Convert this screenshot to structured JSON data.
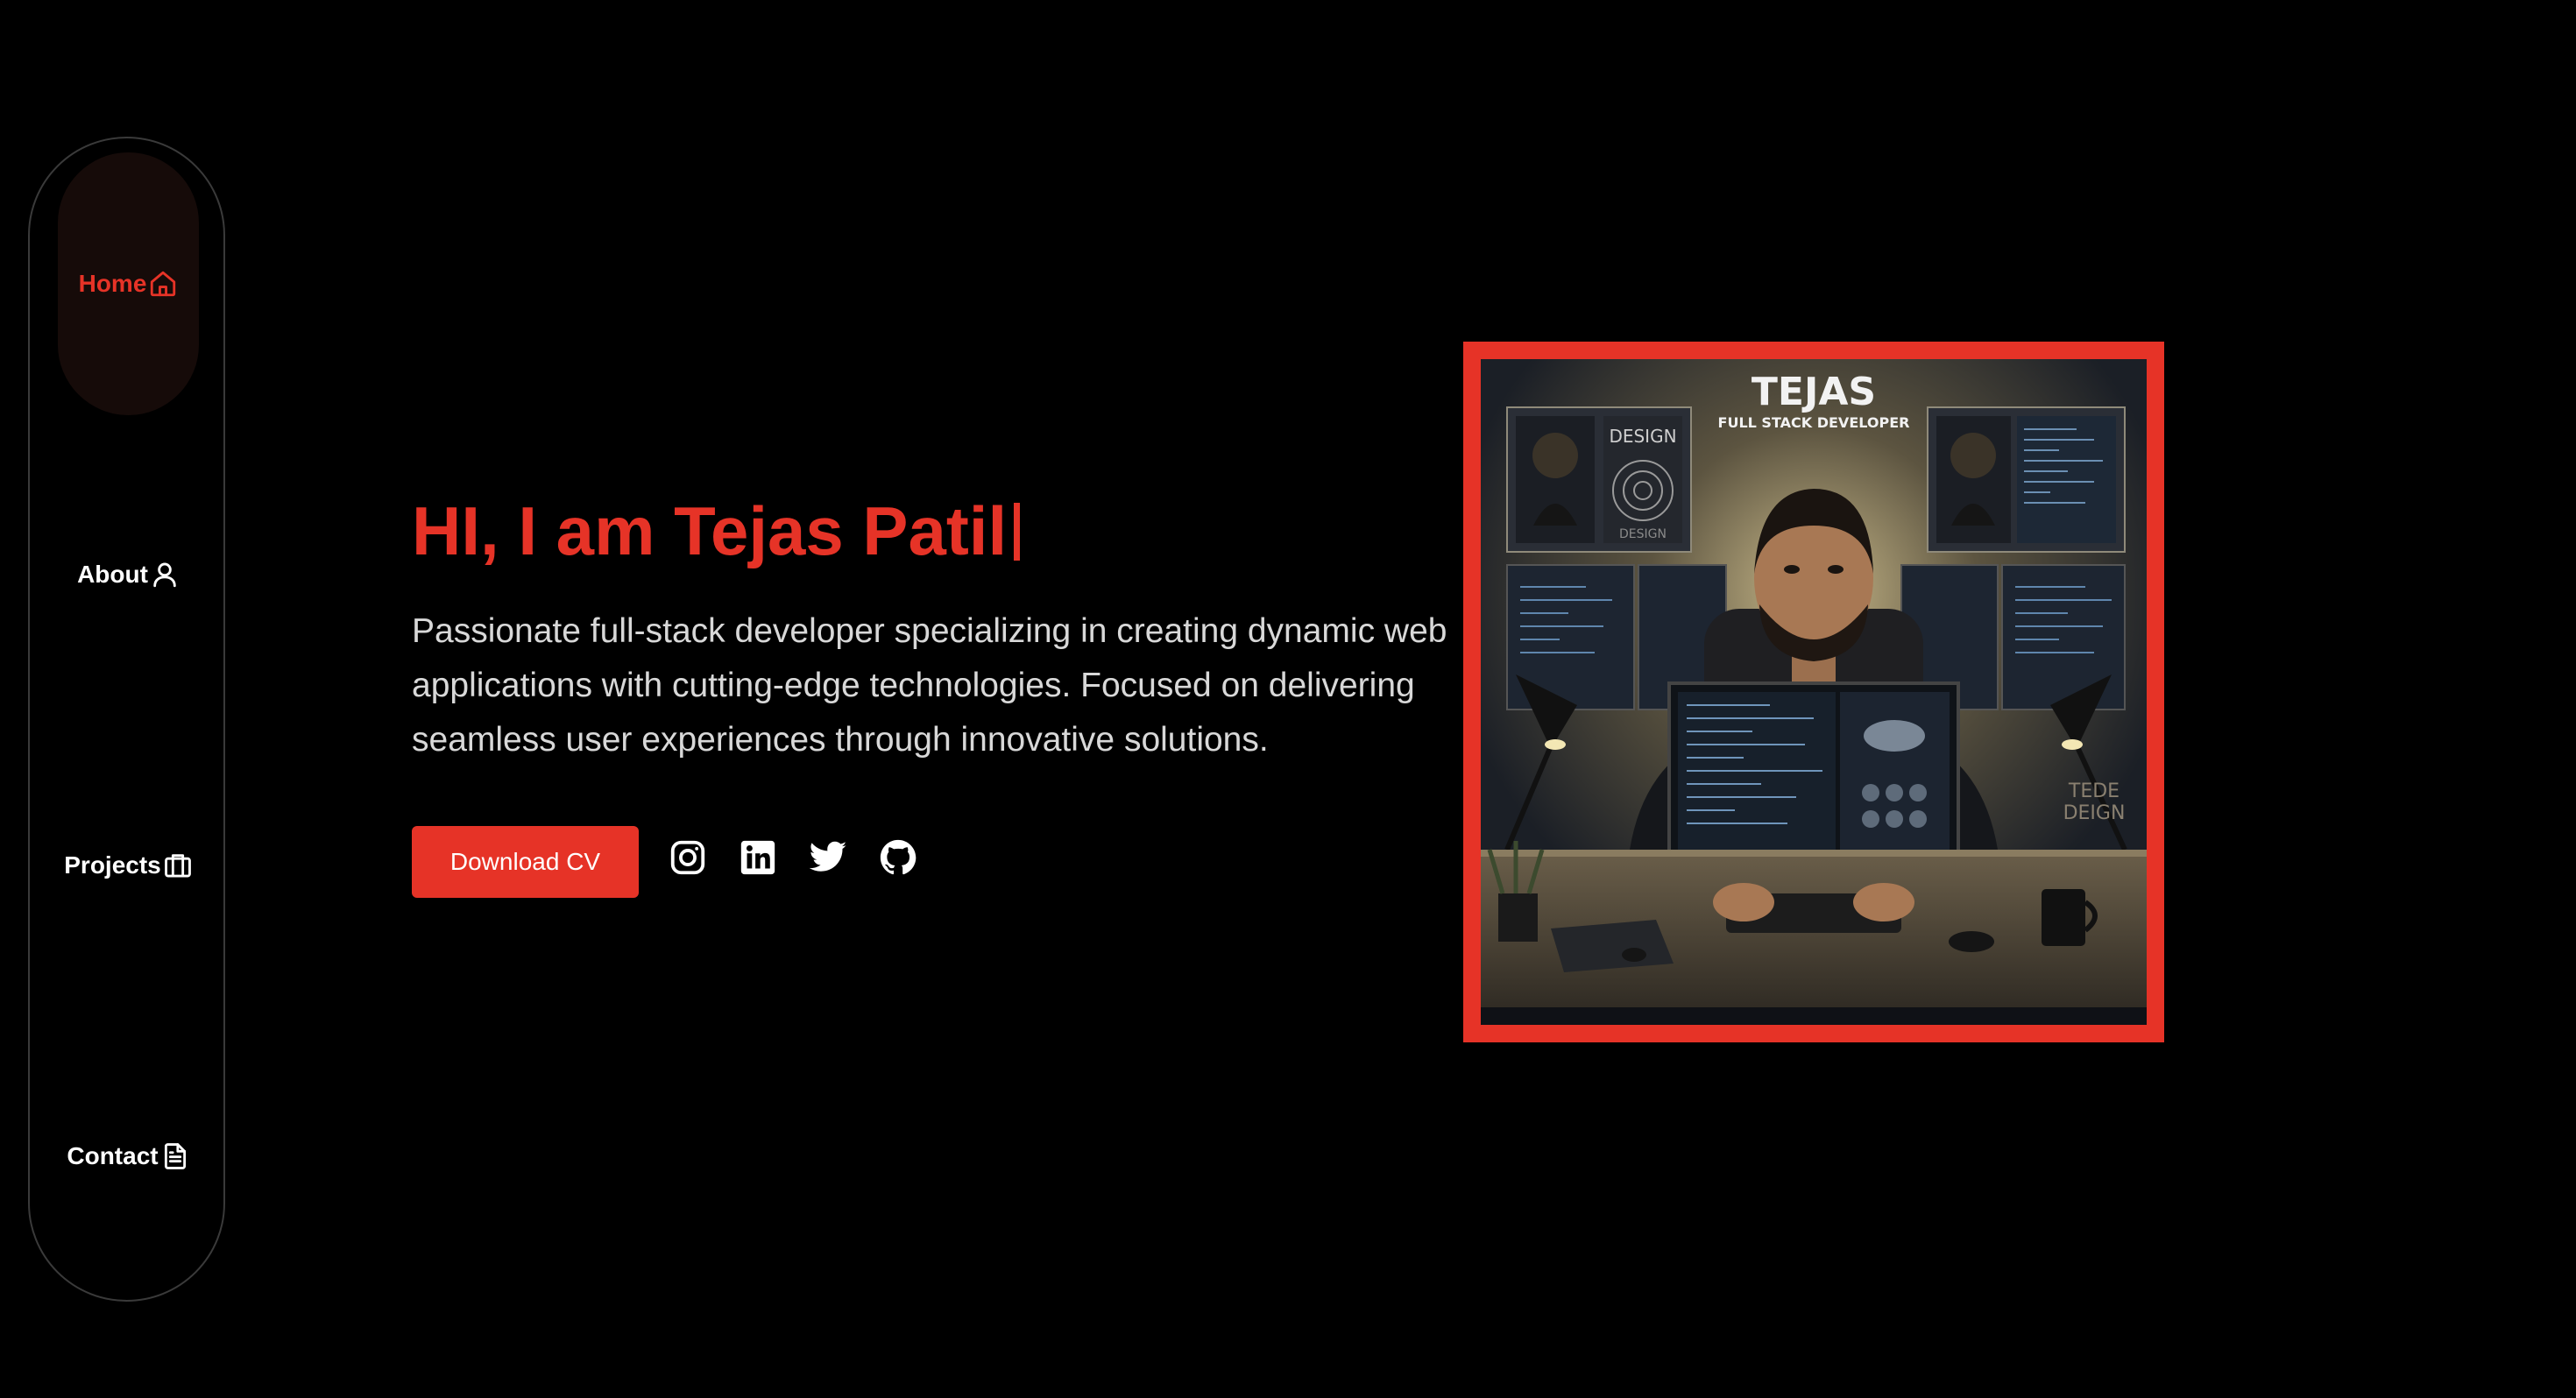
{
  "nav": {
    "items": [
      {
        "label": "Home",
        "icon": "home-icon",
        "active": true
      },
      {
        "label": "About",
        "icon": "user-icon",
        "active": false
      },
      {
        "label": "Projects",
        "icon": "briefcase-icon",
        "active": false
      },
      {
        "label": "Contact",
        "icon": "document-icon",
        "active": false
      }
    ]
  },
  "hero": {
    "title": "HI, I am Tejas Patil",
    "description": "Passionate full-stack developer specializing in creating dynamic web applications with cutting-edge technologies. Focused on delivering seamless user experiences through innovative solutions.",
    "download_label": "Download CV",
    "social": [
      "instagram-icon",
      "linkedin-icon",
      "twitter-icon",
      "github-icon"
    ],
    "image": {
      "heading": "TEJAS",
      "subheading": "FULL STACK DEVELOPER",
      "left_panel_text": "DESIGN",
      "left_panel_caption": "DESIGN",
      "right_desk_text_1": "TEDE",
      "right_desk_text_2": "DEIGN"
    }
  },
  "colors": {
    "accent": "#e63327",
    "background": "#000000",
    "text": "#d8d8d8",
    "active_nav_bg": "#160b09"
  }
}
